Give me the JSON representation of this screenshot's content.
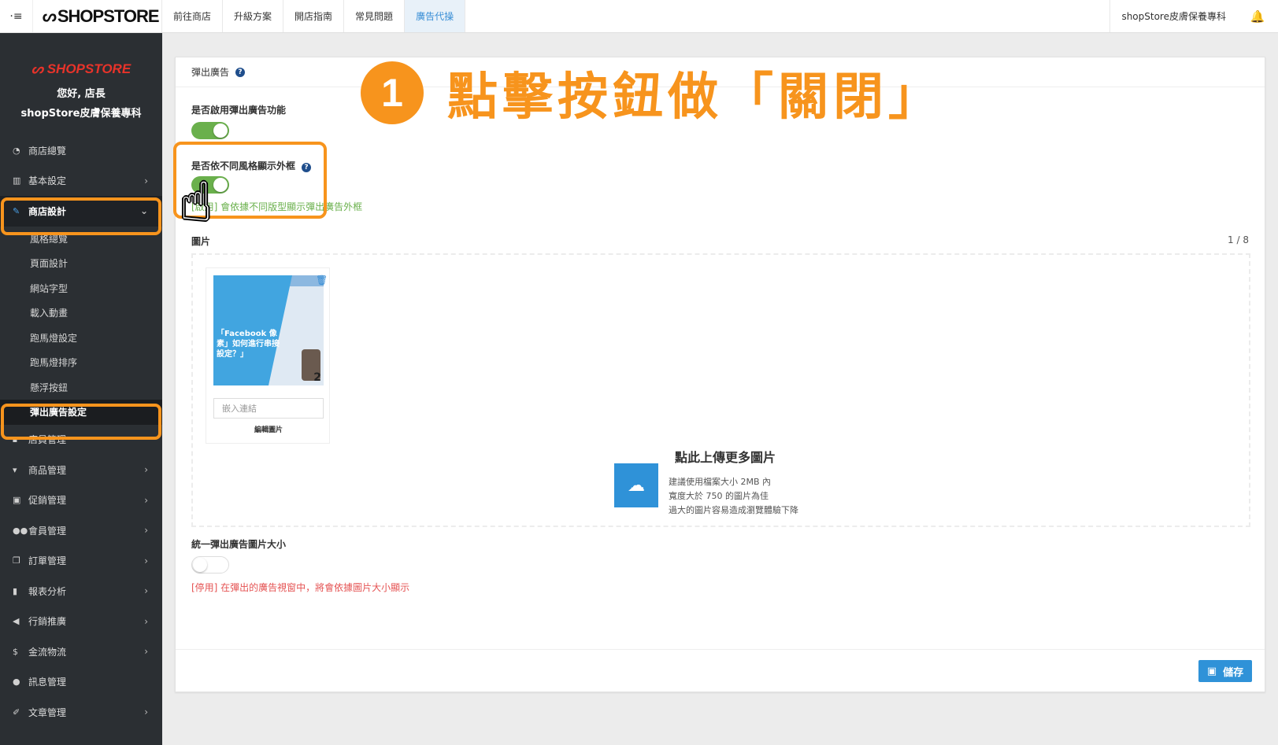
{
  "topbar": {
    "brand": "SHOPSTORE",
    "nav": [
      "前往商店",
      "升級方案",
      "開店指南",
      "常見問題",
      "廣告代操"
    ],
    "active_nav": 4,
    "shop_name": "shopStore皮膚保養專科"
  },
  "sidebar": {
    "logo": "SHOPSTORE",
    "greeting": "您好, 店長",
    "shop_name": "shopStore皮膚保養專科",
    "items": [
      {
        "label": "商店總覽",
        "icon": "dashboard-icon"
      },
      {
        "label": "基本設定",
        "icon": "bank-icon"
      },
      {
        "label": "商店設計",
        "icon": "brush-icon"
      },
      {
        "label": "店員管理",
        "icon": "lock-icon"
      },
      {
        "label": "商品管理",
        "icon": "cart-icon"
      },
      {
        "label": "促銷管理",
        "icon": "gift-icon"
      },
      {
        "label": "會員管理",
        "icon": "users-icon"
      },
      {
        "label": "訂單管理",
        "icon": "copy-icon"
      },
      {
        "label": "報表分析",
        "icon": "bar-chart-icon"
      },
      {
        "label": "行銷推廣",
        "icon": "bullhorn-icon"
      },
      {
        "label": "金流物流",
        "icon": "dollar-icon"
      },
      {
        "label": "訊息管理",
        "icon": "chat-icon"
      },
      {
        "label": "文章管理",
        "icon": "edit-icon"
      }
    ],
    "submenu": [
      "風格總覽",
      "頁面設計",
      "網站字型",
      "載入動畫",
      "跑馬燈設定",
      "跑馬燈排序",
      "懸浮按鈕",
      "彈出廣告設定"
    ]
  },
  "panel": {
    "title": "彈出廣告",
    "enable_label": "是否啟用彈出廣告功能",
    "style_label": "是否依不同風格顯示外框",
    "style_hint": "[啟用] 會依據不同版型顯示彈出廣告外框",
    "images_label": "圖片",
    "counter": "1 / 8",
    "thumb_title": "「Facebook 像素」如何進行串接設定？」",
    "thumb_num": "2",
    "link_placeholder": "嵌入連結",
    "edit_image": "編輯圖片",
    "upload_title": "點此上傳更多圖片",
    "upload_notes": [
      "建議使用檔案大小 2MB 內",
      "寬度大於 750 的圖片為佳",
      "過大的圖片容易造成瀏覽體驗下降"
    ],
    "unify_label": "統一彈出廣告圖片大小",
    "unify_hint": "[停用] 在彈出的廣告視窗中，將會依據圖片大小顯示",
    "save": "儲存"
  },
  "annotation": {
    "step": "1",
    "text": "點擊按鈕做「關閉」"
  },
  "colors": {
    "accent_orange": "#f7941d",
    "switch_on": "#6ab04c",
    "primary_blue": "#2f92d8",
    "sidebar_bg": "#2b2f33"
  }
}
